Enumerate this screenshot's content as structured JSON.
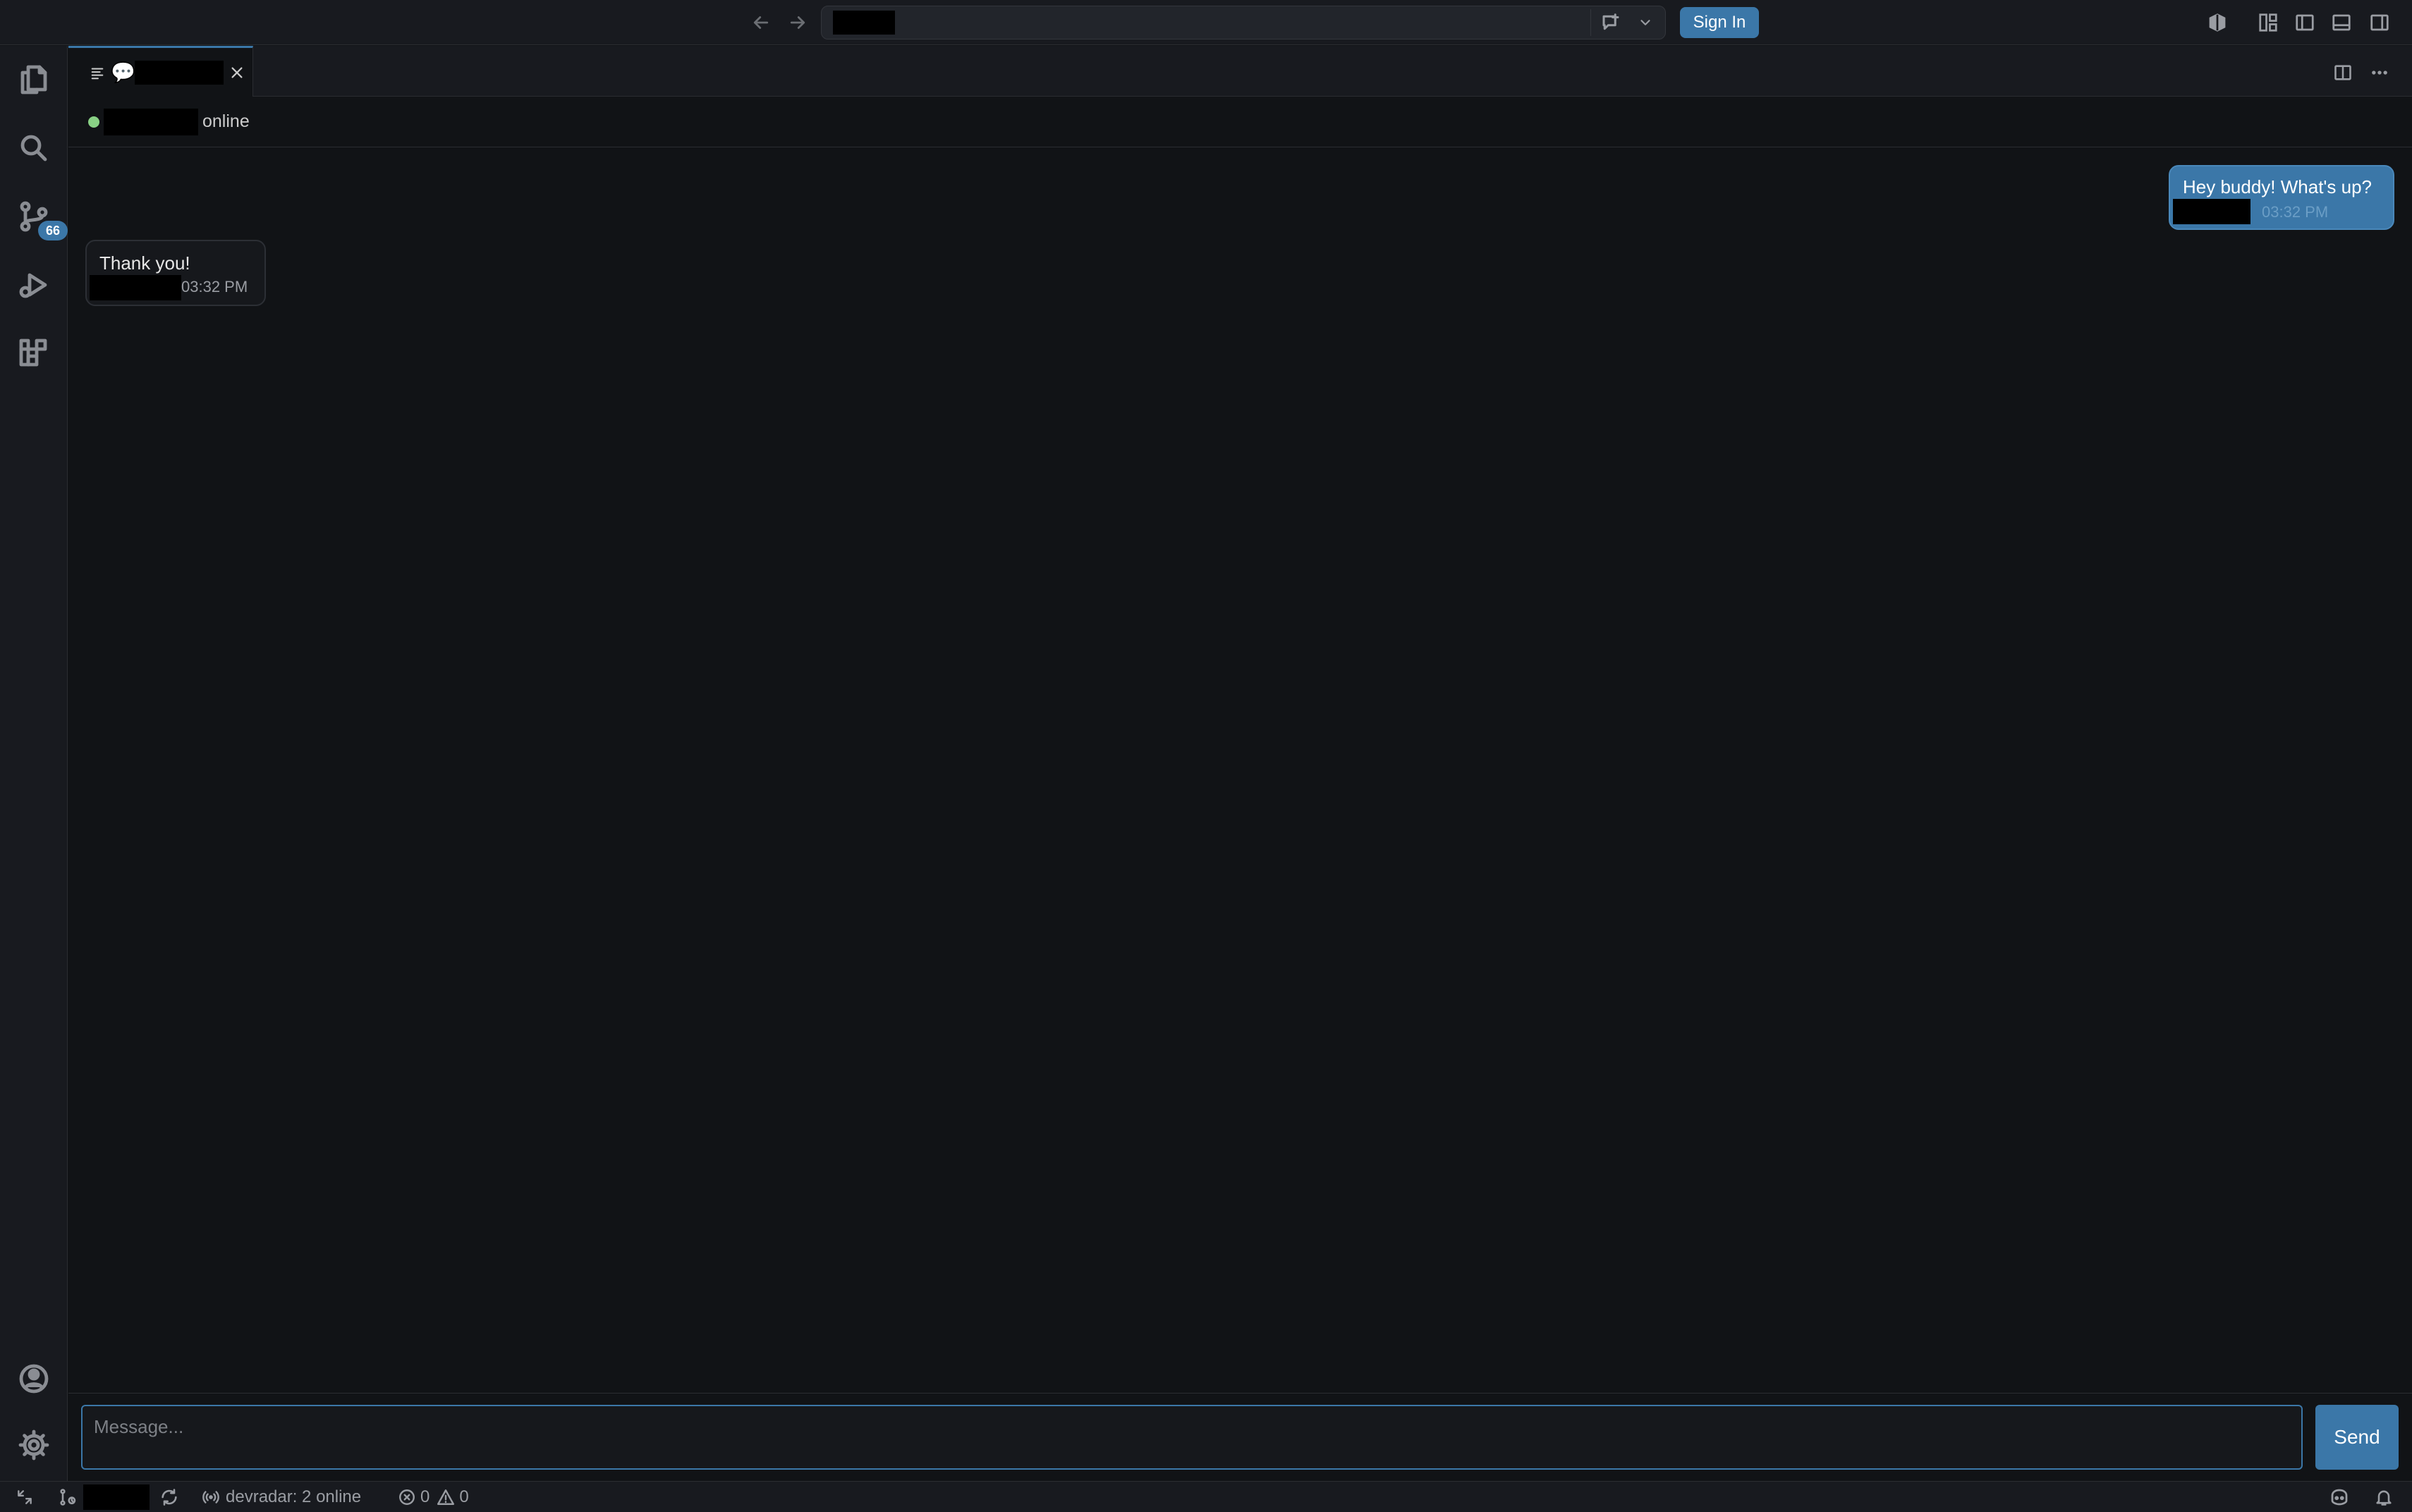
{
  "titlebar": {
    "signin_label": "Sign In"
  },
  "activity": {
    "source_control_badge": "66"
  },
  "tab": {
    "bubble_glyph": "💬"
  },
  "chat": {
    "status": "online",
    "messages": [
      {
        "direction": "outgoing",
        "text": "Hey buddy! What's up?",
        "time": "03:32 PM"
      },
      {
        "direction": "incoming",
        "text": "Thank you!",
        "time": "03:32 PM"
      }
    ]
  },
  "composer": {
    "placeholder": "Message...",
    "send_label": "Send"
  },
  "statusbar": {
    "presence": "devradar: 2 online",
    "errors": "0",
    "warnings": "0"
  },
  "colors": {
    "accent": "#3b77a8",
    "background": "#111316",
    "chrome": "#181a1f",
    "online": "#89d185"
  }
}
